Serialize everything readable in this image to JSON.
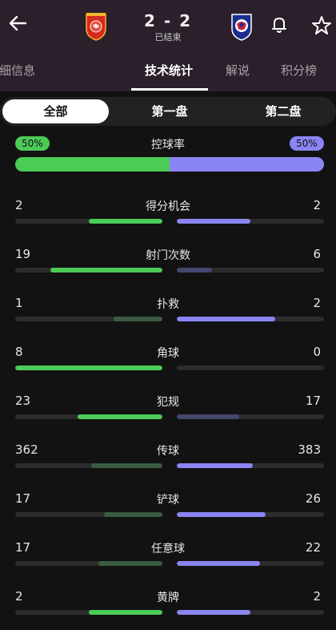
{
  "match": {
    "score": "2 - 2",
    "status": "已结束"
  },
  "tabs": [
    {
      "label": "细信息",
      "active": false
    },
    {
      "label": "技术统计",
      "active": true
    },
    {
      "label": "解说",
      "active": false
    },
    {
      "label": "积分榜",
      "active": false
    }
  ],
  "segments": [
    {
      "label": "全部",
      "active": true
    },
    {
      "label": "第一盘",
      "active": false
    },
    {
      "label": "第二盘",
      "active": false
    }
  ],
  "possession": {
    "label": "控球率",
    "home": "50%",
    "away": "50%",
    "home_value": 50,
    "away_value": 50
  },
  "colors": {
    "home_strong": "#4ccb57",
    "home_weak": "#3a5b41",
    "away_strong": "#8a85f2",
    "away_weak": "#45466e",
    "header_bg": "#2a1f2b",
    "page_bg": "#121212"
  },
  "icons": {
    "back": "arrow-left-icon",
    "bell": "bell-icon",
    "star": "star-outline-icon",
    "home_logo": "team-crest-red-icon",
    "away_logo": "team-crest-blue-icon"
  },
  "stats": [
    {
      "name": "得分机会",
      "home": "2",
      "away": "2"
    },
    {
      "name": "射门次数",
      "home": "19",
      "away": "6"
    },
    {
      "name": "扑救",
      "home": "1",
      "away": "2"
    },
    {
      "name": "角球",
      "home": "8",
      "away": "0"
    },
    {
      "name": "犯规",
      "home": "23",
      "away": "17"
    },
    {
      "name": "传球",
      "home": "362",
      "away": "383"
    },
    {
      "name": "铲球",
      "home": "17",
      "away": "26"
    },
    {
      "name": "任意球",
      "home": "17",
      "away": "22"
    },
    {
      "name": "黄牌",
      "home": "2",
      "away": "2"
    }
  ]
}
